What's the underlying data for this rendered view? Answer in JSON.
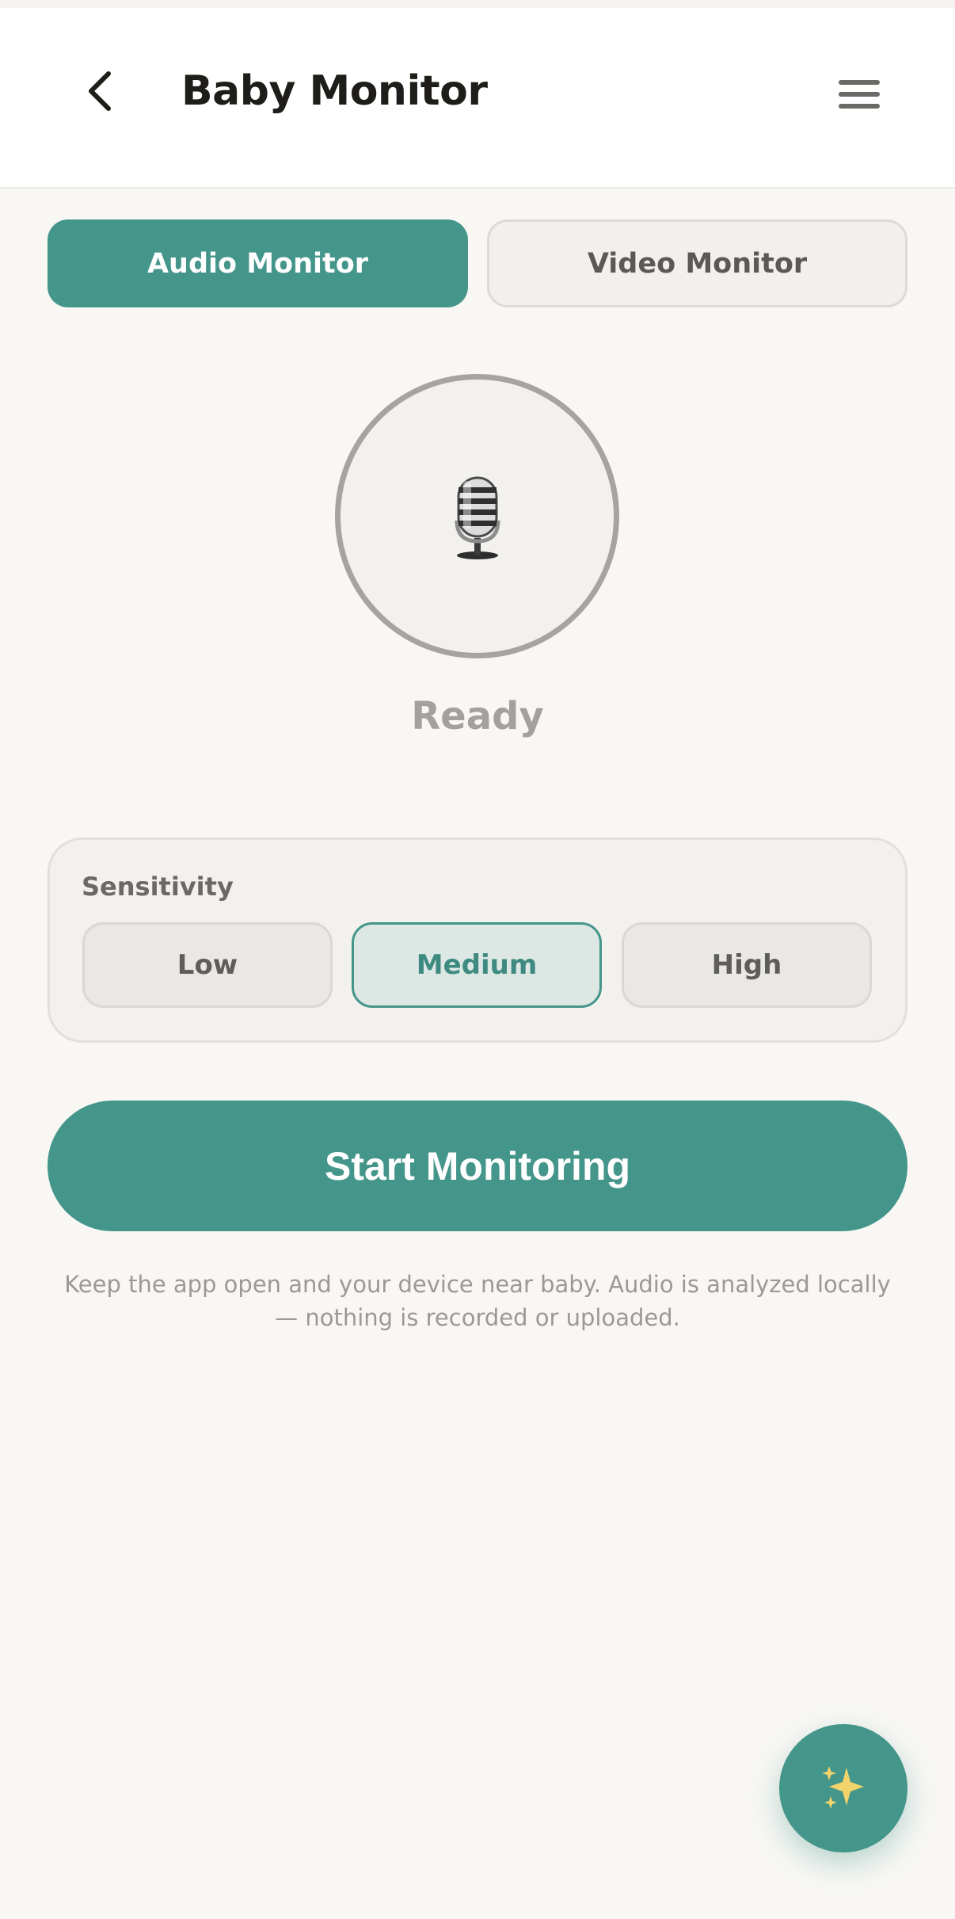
{
  "header": {
    "title": "Baby Monitor",
    "back_icon": "chevron-left-icon",
    "menu_icon": "hamburger-menu-icon"
  },
  "tabs": [
    {
      "label": "Audio Monitor",
      "active": true
    },
    {
      "label": "Video Monitor",
      "active": false
    }
  ],
  "monitor": {
    "icon": "studio-microphone-icon",
    "status": "Ready"
  },
  "sensitivity": {
    "label": "Sensitivity",
    "options": [
      "Low",
      "Medium",
      "High"
    ],
    "selected": "Medium"
  },
  "start_button": {
    "label": "Start Monitoring"
  },
  "note": "Keep the app open and your device near baby. Audio is analyzed locally — nothing is recorded or uploaded.",
  "fab": {
    "icon": "sparkles-icon"
  },
  "colors": {
    "accent": "#44958a",
    "background": "#f8f7f4",
    "sparkle": "#f3d36b"
  }
}
